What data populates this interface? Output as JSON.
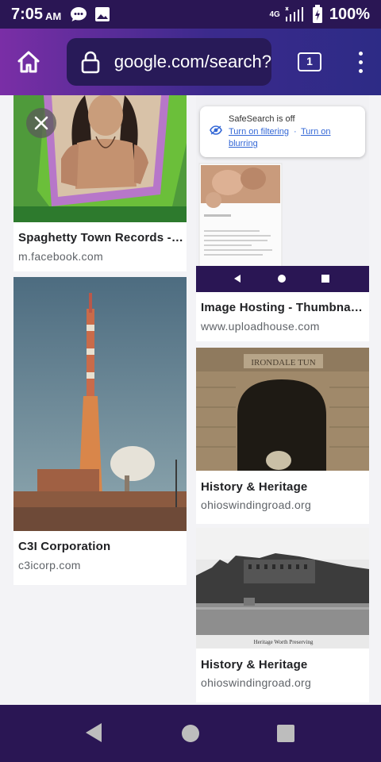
{
  "status": {
    "time": "7:05",
    "ampm": "AM",
    "network": "4G",
    "battery": "100%"
  },
  "browser": {
    "url": "google.com/search?",
    "tab_count": "1"
  },
  "safesearch": {
    "title": "SafeSearch is off",
    "filter_link": "Turn on filtering",
    "separator": "·",
    "blur_link_a": "Turn on",
    "blur_link_b": "blurring"
  },
  "results": [
    {
      "title": "Spaghetty Town Records - F...",
      "source": "m.facebook.com"
    },
    {
      "title": "C3I Corporation",
      "source": "c3icorp.com"
    },
    {
      "title": "Image Hosting - Thumbnail ...",
      "source": "www.uploadhouse.com"
    },
    {
      "title": "History & Heritage",
      "source": "ohioswindingroad.org"
    },
    {
      "title": "History & Heritage",
      "source": "ohioswindingroad.org"
    }
  ],
  "image_texts": {
    "tunnel_sign": "IRONDALE TUN",
    "lake_caption": "Heritage Worth Preserving"
  },
  "colors": {
    "status_bar": "#2a1654",
    "toolbar_start": "#7a2ea6",
    "toolbar_end": "#2d2b86",
    "url_box": "#281a58",
    "link": "#3367d6"
  }
}
